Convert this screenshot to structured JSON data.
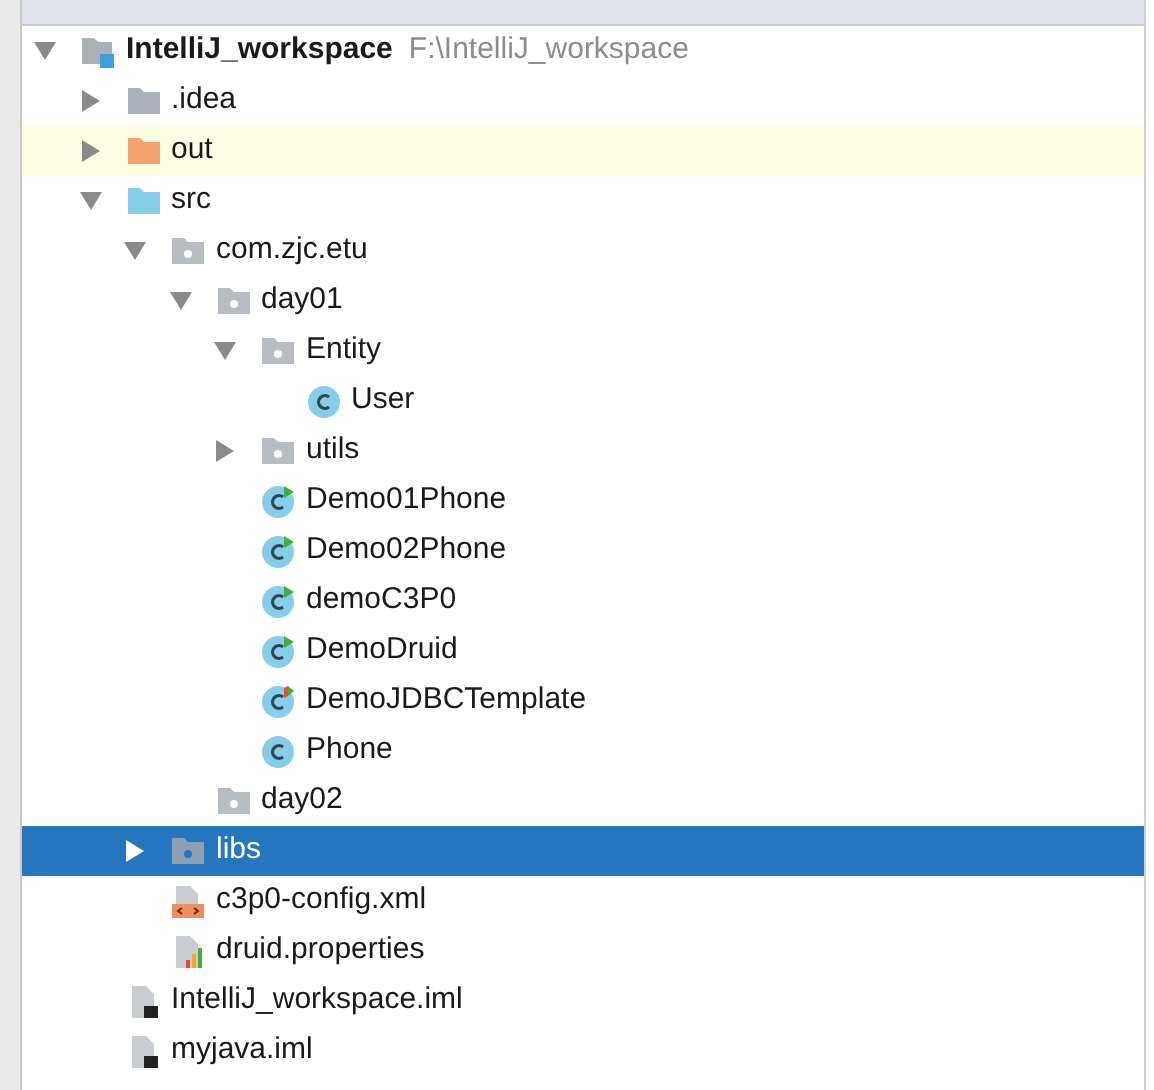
{
  "tree": [
    {
      "label": "IntelliJ_workspace",
      "path": "F:\\IntelliJ_workspace",
      "kind": "module",
      "expanded": true,
      "selected": false,
      "highlighted": false,
      "children": [
        {
          "label": ".idea",
          "kind": "folder",
          "expanded": false,
          "selected": false,
          "highlighted": false
        },
        {
          "label": "out",
          "kind": "excluded-folder",
          "expanded": false,
          "selected": false,
          "highlighted": true
        },
        {
          "label": "src",
          "kind": "source-folder",
          "expanded": true,
          "selected": false,
          "highlighted": false,
          "children": [
            {
              "label": "com.zjc.etu",
              "kind": "package",
              "expanded": true,
              "selected": false,
              "highlighted": false,
              "children": [
                {
                  "label": "day01",
                  "kind": "package",
                  "expanded": true,
                  "selected": false,
                  "highlighted": false,
                  "children": [
                    {
                      "label": "Entity",
                      "kind": "package",
                      "expanded": true,
                      "selected": false,
                      "highlighted": false,
                      "children": [
                        {
                          "label": "User",
                          "kind": "class",
                          "selected": false,
                          "highlighted": false
                        }
                      ]
                    },
                    {
                      "label": "utils",
                      "kind": "package",
                      "expanded": false,
                      "selected": false,
                      "highlighted": false
                    },
                    {
                      "label": "Demo01Phone",
                      "kind": "runnable-class",
                      "selected": false,
                      "highlighted": false
                    },
                    {
                      "label": "Demo02Phone",
                      "kind": "runnable-class",
                      "selected": false,
                      "highlighted": false
                    },
                    {
                      "label": "demoC3P0",
                      "kind": "runnable-class",
                      "selected": false,
                      "highlighted": false
                    },
                    {
                      "label": "DemoDruid",
                      "kind": "runnable-class",
                      "selected": false,
                      "highlighted": false
                    },
                    {
                      "label": "DemoJDBCTemplate",
                      "kind": "test-class",
                      "selected": false,
                      "highlighted": false
                    },
                    {
                      "label": "Phone",
                      "kind": "class",
                      "selected": false,
                      "highlighted": false
                    }
                  ]
                },
                {
                  "label": "day02",
                  "kind": "package",
                  "selected": false,
                  "highlighted": false
                }
              ]
            },
            {
              "label": "libs",
              "kind": "package",
              "expanded": false,
              "selected": true,
              "highlighted": false
            },
            {
              "label": "c3p0-config.xml",
              "kind": "xml",
              "selected": false,
              "highlighted": false
            },
            {
              "label": "druid.properties",
              "kind": "properties",
              "selected": false,
              "highlighted": false
            }
          ]
        },
        {
          "label": "IntelliJ_workspace.iml",
          "kind": "iml",
          "selected": false,
          "highlighted": false
        },
        {
          "label": "myjava.iml",
          "kind": "iml",
          "selected": false,
          "highlighted": false
        }
      ]
    }
  ]
}
